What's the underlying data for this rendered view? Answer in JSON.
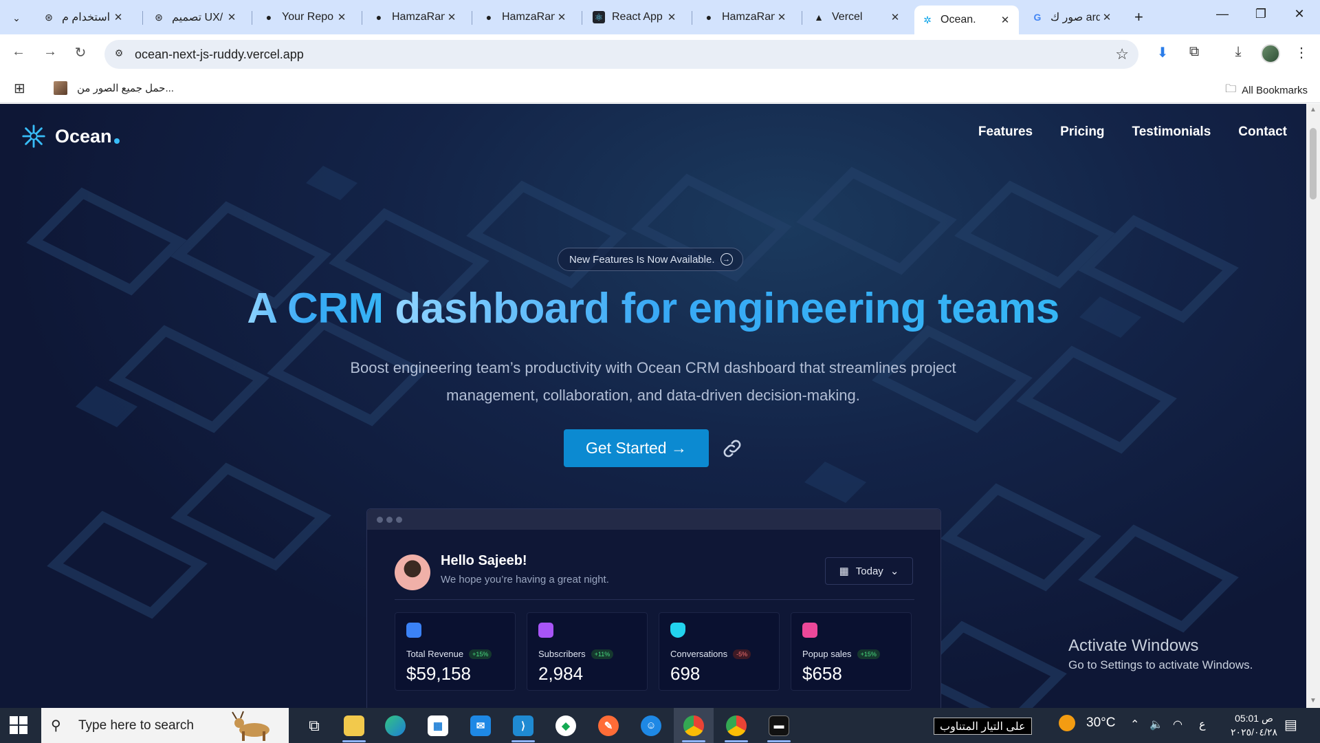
{
  "browser": {
    "tabs": [
      {
        "title": "استخدام م",
        "icon": "openai-icon"
      },
      {
        "title": "تصميم UX/",
        "icon": "openai-icon"
      },
      {
        "title": "Your Repo",
        "icon": "github-icon"
      },
      {
        "title": "HamzaRan",
        "icon": "github-icon"
      },
      {
        "title": "HamzaRan",
        "icon": "github-icon"
      },
      {
        "title": "React App",
        "icon": "react-icon"
      },
      {
        "title": "HamzaRan",
        "icon": "github-icon"
      },
      {
        "title": "Vercel",
        "icon": "vercel-icon"
      },
      {
        "title": "Ocean.",
        "icon": "ocean-icon",
        "active": true
      },
      {
        "title": "صور ك ard",
        "icon": "google-icon"
      }
    ],
    "url": "ocean-next-js-ruddy.vercel.app",
    "bookmarks": {
      "item_label": "حمل جميع الصور من...",
      "all_label": "All Bookmarks"
    }
  },
  "site": {
    "brand": "Ocean",
    "nav": [
      "Features",
      "Pricing",
      "Testimonials",
      "Contact"
    ],
    "announcement": "New Features Is Now Available.",
    "hero_title_part1": "A CRM ",
    "hero_title_part2": "dashboard for engineering teams",
    "hero_subtitle": "Boost engineering team’s productivity with Ocean CRM dashboard that streamlines project management, collaboration, and data-driven decision-making.",
    "cta_label": "Get Started →",
    "accent_color": "#0c8ad1"
  },
  "dashboard": {
    "greeting": "Hello Sajeeb!",
    "greeting_sub": "We hope you’re having a great night.",
    "date_filter": "Today",
    "stats": [
      {
        "label": "Total Revenue",
        "change": "+15%",
        "value": "$59,158",
        "trend": "up",
        "color": "#3b82f6"
      },
      {
        "label": "Subscribers",
        "change": "+11%",
        "value": "2,984",
        "trend": "up",
        "color": "#a855f7"
      },
      {
        "label": "Conversations",
        "change": "-5%",
        "value": "698",
        "trend": "down",
        "color": "#22d3ee"
      },
      {
        "label": "Popup sales",
        "change": "+15%",
        "value": "$658",
        "trend": "up",
        "color": "#ec4899"
      }
    ]
  },
  "watermark": {
    "line1": "Activate Windows",
    "line2": "Go to Settings to activate Windows."
  },
  "taskbar": {
    "search_placeholder": "Type here to search",
    "news_text": "على التيار المتناوب",
    "temperature": "30°C",
    "lang": "ع",
    "time": "05:01 ص",
    "date": "٢٠٢٥/٠٤/٢٨"
  }
}
